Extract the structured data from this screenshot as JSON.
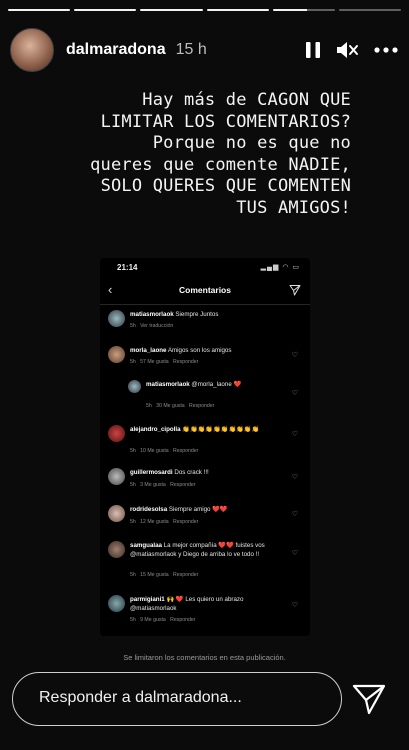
{
  "story": {
    "username": "dalmaradona",
    "age": "15 h",
    "caption": "Hay más de CAGON QUE\nLIMITAR LOS COMENTARIOS?\nPorque no es que no\nqueres que comente NADIE,\nSOLO QUERES QUE COMENTEN\nTUS AMIGOS!",
    "progress": {
      "segments": 6,
      "completed": 4,
      "current_fraction": 0.55
    }
  },
  "screenshot": {
    "time": "21:14",
    "title": "Comentarios",
    "comments": [
      {
        "user": "matiasmorlaok",
        "text": "Siempre Juntos",
        "age": "5h",
        "likes": "",
        "extra": "Ver traducción"
      },
      {
        "user": "morla_laone",
        "text": "Amigos son los amigos",
        "age": "5h",
        "likes": "57 Me gusta",
        "extra": "Responder"
      },
      {
        "user": "matiasmorlaok",
        "text": "@morla_laone ❤️",
        "age": "5h",
        "likes": "30 Me gusta",
        "extra": "Responder"
      },
      {
        "user": "alejandro_cipolla",
        "text": "👏👏👏👏👏👏👏👏👏👏",
        "age": "5h",
        "likes": "10 Me gusta",
        "extra": "Responder"
      },
      {
        "user": "guillermosardi",
        "text": "Dos crack !!!",
        "age": "5h",
        "likes": "3 Me gusta",
        "extra": "Responder"
      },
      {
        "user": "rodridesolsa",
        "text": "Siempre amigo ❤️❤️",
        "age": "5h",
        "likes": "12 Me gusta",
        "extra": "Responder"
      },
      {
        "user": "samgualaa",
        "text": "La mejor compañía ❤️❤️ fuistes vos @matiasmorlaok y Diego de arriba lo ve todo !!",
        "age": "5h",
        "likes": "15 Me gusta",
        "extra": "Responder"
      },
      {
        "user": "parmigiani1",
        "text": "🙌 ❤️ Les quiero un abrazo @matiasmorlaok",
        "age": "5h",
        "likes": "9 Me gusta",
        "extra": "Responder"
      }
    ],
    "limit_note": "Se limitaron los comentarios en esta publicación."
  },
  "reply": {
    "placeholder": "Responder a dalmaradona..."
  }
}
